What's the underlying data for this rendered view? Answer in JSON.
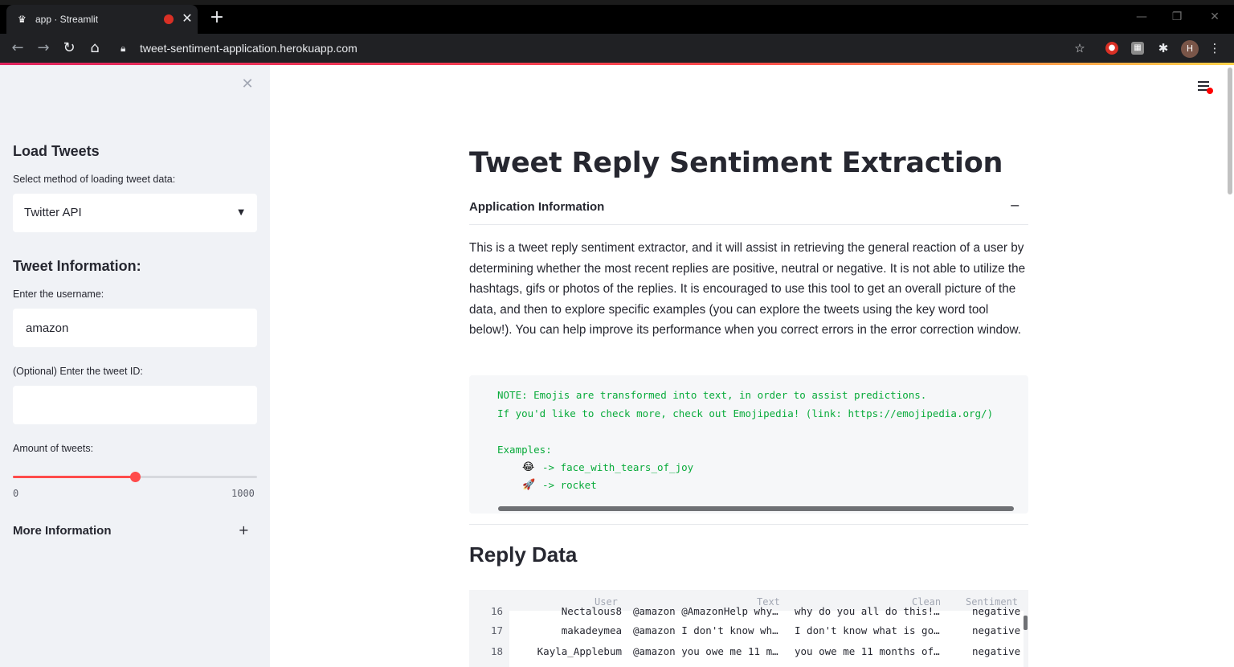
{
  "browser": {
    "tab_title": "app · Streamlit",
    "new_tab": "+",
    "url": "tweet-sentiment-application.herokuapp.com",
    "window_controls": [
      "—",
      "❐",
      "✕"
    ]
  },
  "sidebar": {
    "close": "✕",
    "load_heading": "Load Tweets",
    "method_label": "Select method of loading tweet data:",
    "method_value": "Twitter API",
    "tweet_heading": "Tweet Information:",
    "username_label": "Enter the username:",
    "username_value": "amazon",
    "tweet_id_label": "(Optional) Enter the tweet ID:",
    "tweet_id_value": "",
    "amount_label": "Amount of tweets:",
    "slider": {
      "min": "0",
      "max": "1000",
      "value": 500
    },
    "more_info": "More Information",
    "more_info_toggle": "+"
  },
  "main": {
    "title": "Tweet Reply Sentiment Extraction",
    "expander_label": "Application Information",
    "expander_toggle": "−",
    "info_text": "This is a tweet reply sentiment extractor, and it will assist in retrieving the general reaction of a user by determining whether the most recent replies are positive, neutral or negative. It is not able to utilize the hashtags, gifs or photos of the replies. It is encouraged to use this tool to get an overall picture of the data, and then to explore specific examples (you can explore the tweets using the key word tool below!). You can help improve its performance when you correct errors in the error correction window.",
    "code": {
      "line1": "NOTE: Emojis are transformed into text, in order to assist predictions.",
      "line2": "If you'd like to check more, check out Emojipedia! (link: https://emojipedia.org/)",
      "line3": "Examples:",
      "ex1_emoji": "😂",
      "ex1_text": "-> face_with_tears_of_joy",
      "ex2_emoji": "🚀",
      "ex2_text": "-> rocket"
    },
    "reply_heading": "Reply Data",
    "table": {
      "headers": [
        "User",
        "Text",
        "Clean",
        "Sentiment"
      ],
      "rows": [
        {
          "idx": "16",
          "user": "Nectalous8",
          "text": "@amazon @AmazonHelp why…",
          "clean": "why do you all do this!…",
          "sentiment": "negative"
        },
        {
          "idx": "17",
          "user": "makadeymea",
          "text": "@amazon I don't know wh…",
          "clean": "I don't know what is go…",
          "sentiment": "negative"
        },
        {
          "idx": "18",
          "user": "Kayla_Applebum",
          "text": "@amazon you owe me 11 m…",
          "clean": "you owe me 11 months of…",
          "sentiment": "negative"
        }
      ]
    }
  }
}
